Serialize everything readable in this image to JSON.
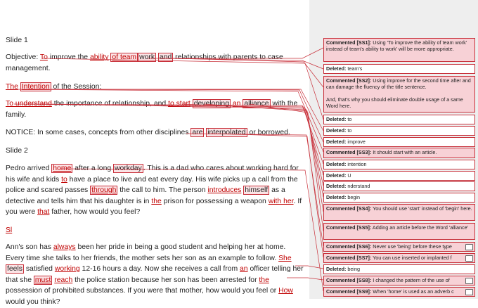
{
  "document": {
    "slide1_heading": "Slide 1",
    "objective": {
      "start": "Objective: ",
      "w_to": "To",
      "s1": " improve the ",
      "w_ability": "ability",
      "w_ofteam": "of team",
      "w_work": "work",
      "w_and": "and",
      "s2": " relationships with parents to case management."
    },
    "intention": {
      "w_the": "The",
      "w_intention": "Intention",
      "rest": " of the Session:"
    },
    "understand": {
      "w_to_understand": "To understand",
      "s1": " the importance of relationship, and ",
      "w_to_start": "to start",
      "s2": " ",
      "w_developing": "developing",
      "s3": " ",
      "w_an": "an",
      "s4": " ",
      "w_alliance": "alliance",
      "s5": " with the family."
    },
    "notice": {
      "start": "NOTICE: In some cases, concepts from other disciplines ",
      "w_are": "are",
      "s1": " ",
      "w_interpolated": "interpolated",
      "s2": " or borrowed."
    },
    "slide2_heading": "Slide 2",
    "pedro": {
      "t1": "Pedro arrived ",
      "w_home": "home",
      "t2": " after a long ",
      "w_workday": "workday",
      "t3": ". This is a dad who cares about working hard for his wife and kids ",
      "w_to": "to",
      "t4": " have a place to live and eat every day. His wife picks up a call from the police and scared passes ",
      "w_through": "through",
      "t5": " the call to him. The person ",
      "w_introduces": "introduces",
      "t6": " ",
      "w_himself": "himself",
      "t7": " as a detective and tells him that his daughter is in ",
      "w_the": "the",
      "t8": " prison for possessing a weapon ",
      "w_withher": "with her",
      "t9": ". If you were ",
      "w_that": "that",
      "t10": " father, how would you feel?"
    },
    "sl_marker": "Sl",
    "ann": {
      "t1": "Ann's son has ",
      "w_always": "always",
      "t2": " been her pride in being a good student and helping her at home. Every time she talks to her friends, the mother sets her son as an example to follow. ",
      "w_she": "She",
      "t3": " ",
      "w_feels": "feels",
      "t4": " satisfied ",
      "w_working": "working",
      "t5": " 12-16 hours a day. Now she receives a call from ",
      "w_an": "an",
      "t6": " officer telling her that she ",
      "w_must": "must",
      "t7": " ",
      "w_reach": "reach",
      "t8": " the police station because her son has been arrested for ",
      "w_the": "the",
      "t9": " possession of prohibited substances. If you were that mother, how would you feel or ",
      "w_how": "How",
      "t10": " would you think?"
    }
  },
  "balloons": [
    {
      "type": "comment",
      "label": "Commented [SS1]:",
      "text": " Using 'To improve the ability of team work' instead of team's ability to work' will be more appropriate."
    },
    {
      "type": "deleted",
      "label": "Deleted:",
      "text": " team's"
    },
    {
      "type": "comment",
      "label": "Commented [SS2]:",
      "text": " Using improve for the second time after and can damage the fluency of the title sentence.\n\nAnd, that's why you should eliminate double usage of a same Word here."
    },
    {
      "type": "deleted",
      "label": "Deleted:",
      "text": " to"
    },
    {
      "type": "deleted",
      "label": "Deleted:",
      "text": " to"
    },
    {
      "type": "deleted",
      "label": "Deleted:",
      "text": " improve"
    },
    {
      "type": "comment",
      "label": "Commented [SS3]:",
      "text": " It should start with an article."
    },
    {
      "type": "deleted",
      "label": "Deleted:",
      "text": " intention"
    },
    {
      "type": "deleted",
      "label": "Deleted:",
      "text": " U"
    },
    {
      "type": "deleted",
      "label": "Deleted:",
      "text": " nderstand"
    },
    {
      "type": "deleted",
      "label": "Deleted:",
      "text": " begin"
    },
    {
      "type": "comment",
      "label": "Commented [SS4]:",
      "text": " You should use 'start' instead of 'begin' here."
    },
    {
      "type": "comment",
      "label": "Commented [SS5]:",
      "text": " Adding an article before the Word 'alliance'"
    },
    {
      "type": "comment",
      "label": "Commented [SS6]:",
      "text": " Never use 'being' before these type"
    },
    {
      "type": "comment",
      "label": "Commented [SS7]:",
      "text": " You can use inserted or implanted f"
    },
    {
      "type": "deleted",
      "label": "Deleted:",
      "text": " being"
    },
    {
      "type": "comment",
      "label": "Commented [SS8]:",
      "text": " I changed the pattern of the use of"
    },
    {
      "type": "comment",
      "label": "Commented [SS9]:",
      "text": " When 'home' is used as an adverb c"
    }
  ],
  "colors": {
    "accent": "#c8303a",
    "comment_bg": "#f7d1d6",
    "insert_text": "#c00000",
    "margin_bg": "#eeeeee"
  }
}
